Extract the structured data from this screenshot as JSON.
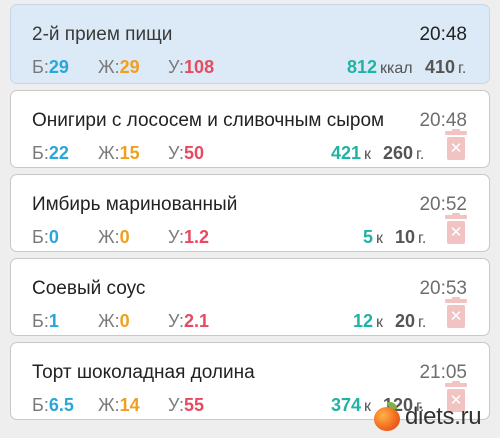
{
  "header": {
    "title": "2-й прием пищи",
    "time": "20:48",
    "b_label": "Б:",
    "b_value": "29",
    "j_label": "Ж:",
    "j_value": "29",
    "u_label": "У:",
    "u_value": "108",
    "kcal_value": "812",
    "kcal_unit": "ккал",
    "grams_value": "410",
    "grams_unit": "г."
  },
  "items": [
    {
      "title": "Онигири с лососем и сливочным сыром",
      "time": "20:48",
      "b_label": "Б:",
      "b_value": "22",
      "j_label": "Ж:",
      "j_value": "15",
      "u_label": "У:",
      "u_value": "50",
      "kcal_value": "421",
      "kcal_unit": "к",
      "grams_value": "260",
      "grams_unit": "г."
    },
    {
      "title": "Имбирь маринованный",
      "time": "20:52",
      "b_label": "Б:",
      "b_value": "0",
      "j_label": "Ж:",
      "j_value": "0",
      "u_label": "У:",
      "u_value": "1.2",
      "kcal_value": "5",
      "kcal_unit": "к",
      "grams_value": "10",
      "grams_unit": "г."
    },
    {
      "title": "Соевый соус",
      "time": "20:53",
      "b_label": "Б:",
      "b_value": "1",
      "j_label": "Ж:",
      "j_value": "0",
      "u_label": "У:",
      "u_value": "2.1",
      "kcal_value": "12",
      "kcal_unit": "к",
      "grams_value": "20",
      "grams_unit": "г."
    },
    {
      "title": "Торт шоколадная долина",
      "time": "21:05",
      "b_label": "Б:",
      "b_value": "6.5",
      "j_label": "Ж:",
      "j_value": "14",
      "u_label": "У:",
      "u_value": "55",
      "kcal_value": "374",
      "kcal_unit": "к",
      "grams_value": "120",
      "grams_unit": "г."
    }
  ],
  "watermark": {
    "text": "diets.ru",
    "icon": "apple-icon"
  },
  "icons": {
    "delete": "trash-icon",
    "delete_glyph": "✕"
  },
  "colors": {
    "protein": "#2aa6d9",
    "fat": "#f0a020",
    "carbs": "#e84a5f",
    "kcal": "#1fb3a3",
    "header_bg": "#dbeaf6",
    "trash": "#f2c3c3"
  }
}
